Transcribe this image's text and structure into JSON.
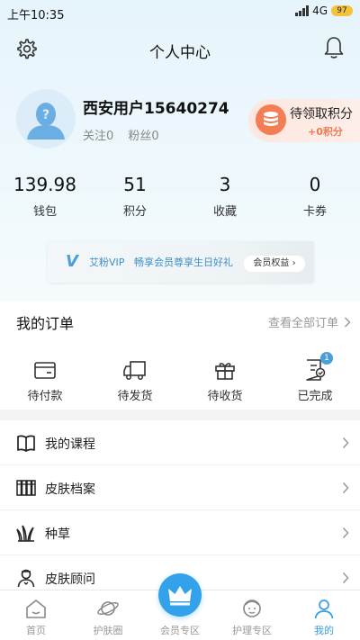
{
  "status_bar": {
    "time": "上午10:35",
    "network": "4G",
    "battery": "97"
  },
  "header": {
    "title": "个人中心"
  },
  "profile": {
    "username": "西安用户15640274",
    "following": "关注0",
    "followers": "粉丝0"
  },
  "points_card": {
    "title": "待领取积分",
    "amount": "+0积分"
  },
  "stats": [
    {
      "value": "139.98",
      "label": "钱包"
    },
    {
      "value": "51",
      "label": "积分"
    },
    {
      "value": "3",
      "label": "收藏"
    },
    {
      "value": "0",
      "label": "卡券"
    }
  ],
  "vip_banner": {
    "logo": "V",
    "brand": "艾粉VIP",
    "slogan": "畅享会员尊享生日好礼",
    "button": "会员权益 ›"
  },
  "orders": {
    "title": "我的订单",
    "view_all": "查看全部订单",
    "items": [
      {
        "label": "待付款",
        "icon": "wallet-icon"
      },
      {
        "label": "待发货",
        "icon": "truck-icon"
      },
      {
        "label": "待收货",
        "icon": "gift-box-icon"
      },
      {
        "label": "已完成",
        "icon": "done-doc-icon",
        "badge": "1"
      }
    ]
  },
  "menu": [
    {
      "label": "我的课程",
      "icon": "book-icon"
    },
    {
      "label": "皮肤档案",
      "icon": "files-icon"
    },
    {
      "label": "种草",
      "icon": "grass-icon"
    },
    {
      "label": "皮肤顾问",
      "icon": "consultant-icon"
    }
  ],
  "tabbar": [
    {
      "label": "首页",
      "icon": "home-icon",
      "active": false
    },
    {
      "label": "护肤圈",
      "icon": "planet-icon",
      "active": false
    },
    {
      "label": "会员专区",
      "icon": "crown-icon",
      "active": false
    },
    {
      "label": "护理专区",
      "icon": "face-care-icon",
      "active": false
    },
    {
      "label": "我的",
      "icon": "person-icon",
      "active": true
    }
  ],
  "colors": {
    "accent": "#34a2ea",
    "points_orange": "#f47d56",
    "hero_bg": "#e6f4fb"
  }
}
